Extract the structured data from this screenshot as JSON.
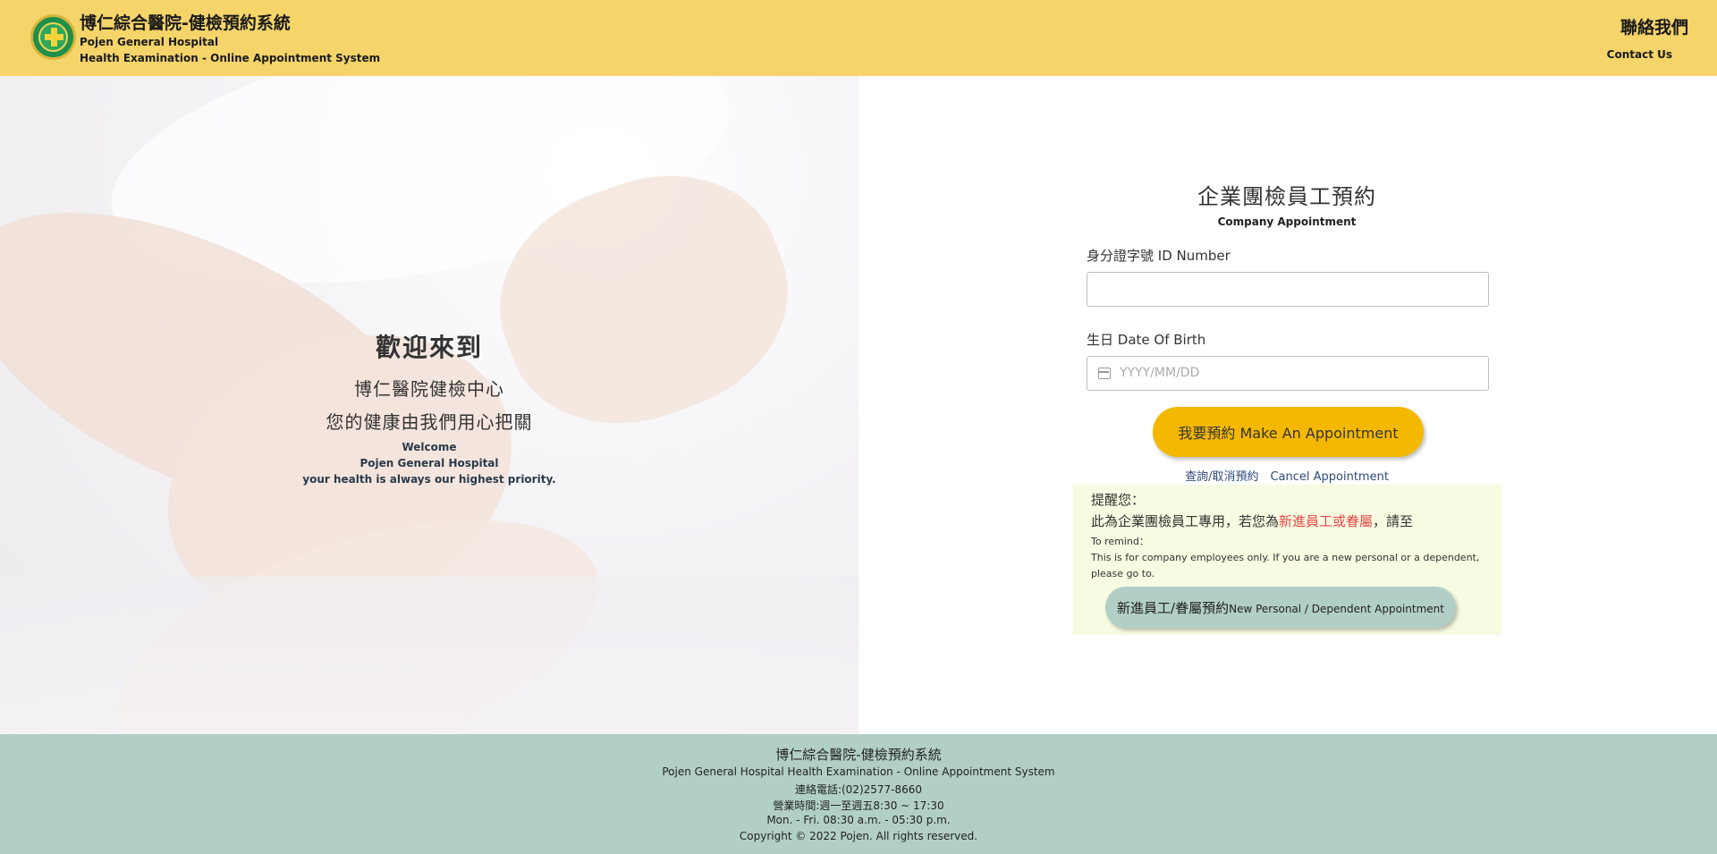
{
  "header": {
    "brand_zh": "博仁綜合醫院-健檢預約系統",
    "brand_en_1": "Pojen General Hospital",
    "brand_en_2": "Health Examination - Online Appointment System",
    "contact_zh": "聯絡我們",
    "contact_en": "Contact Us"
  },
  "hero": {
    "title": "歡迎來到",
    "line1": "博仁醫院健檢中心",
    "line2": "您的健康由我們用心把關",
    "en_1": "Welcome",
    "en_2": "Pojen General Hospital",
    "en_3": "your health is always our highest priority."
  },
  "form": {
    "title": "企業團檢員工預約",
    "subtitle": "Company Appointment",
    "id_label": "身分證字號 ID Number",
    "id_value": "",
    "dob_label": "生日 Date Of Birth",
    "dob_placeholder": "YYYY/MM/DD",
    "submit_label": "我要預約 Make An Appointment",
    "cancel_label": "查詢/取消預約　Cancel Appointment"
  },
  "reminder": {
    "title": "提醒您：",
    "line_prefix": "此為企業團檢員工專用，若您為",
    "line_highlight": "新進員工或眷屬",
    "line_suffix": "，請至",
    "en_title": "To remind：",
    "en_body": "This is for company employees only. If you are a new personal or a dependent, please go to.",
    "button_zh": "新進員工/眷屬預約",
    "button_en": "New Personal / Dependent Appointment"
  },
  "footer": {
    "title": "博仁綜合醫院-健檢預約系統",
    "line1": "Pojen General Hospital Health Examination - Online Appointment System",
    "phone": "連絡電話:(02)2577-8660",
    "hours_zh": "營業時間:週一至週五8:30 ~ 17:30",
    "hours_en": "Mon. - Fri. 08:30 a.m. - 05:30 p.m.",
    "copyright": "Copyright © 2022 Pojen. All rights reserved."
  },
  "colors": {
    "header_bg": "#f5d46a",
    "primary_button": "#f5b800",
    "secondary_button": "#b2cfc7",
    "footer_bg": "#b2cfc7",
    "reminder_bg": "#f6fbe1",
    "highlight_red": "#e84848",
    "link": "#2d4a7a"
  },
  "icons": {
    "logo": "hospital-cross-logo",
    "date": "calendar-icon"
  }
}
